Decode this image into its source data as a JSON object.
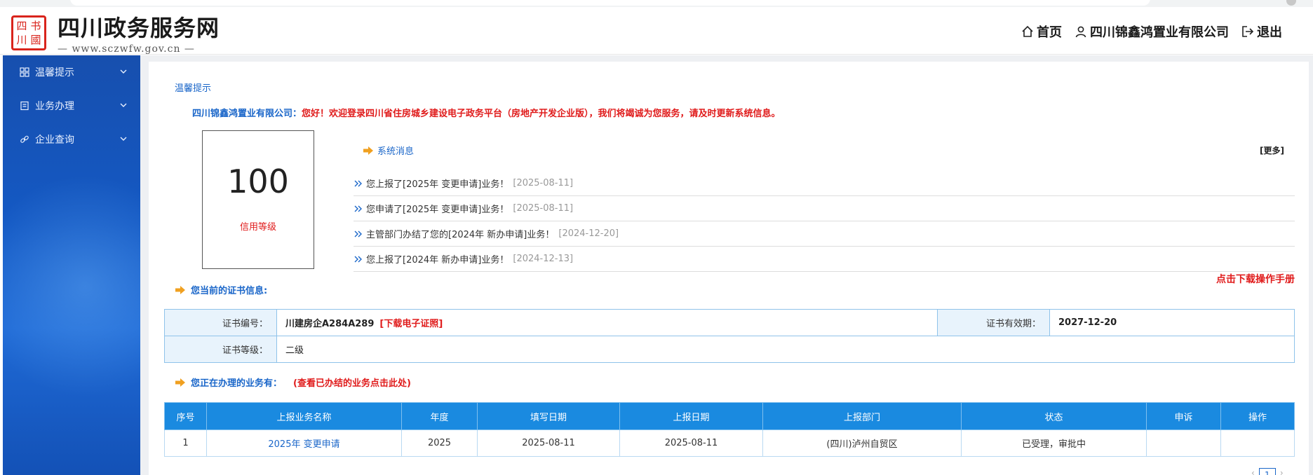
{
  "header": {
    "logo_seal_chars": [
      "四",
      "书",
      "川",
      "國"
    ],
    "site_title": "四川政务服务网",
    "site_url": "www.sczwfw.gov.cn",
    "nav": {
      "home": "首页",
      "company": "四川锦鑫鸿置业有限公司",
      "logout": "退出"
    }
  },
  "sidebar": {
    "items": [
      {
        "label": "温馨提示",
        "icon": "grid-icon"
      },
      {
        "label": "业务办理",
        "icon": "document-icon"
      },
      {
        "label": "企业查询",
        "icon": "link-icon"
      }
    ]
  },
  "main": {
    "tip_title": "温馨提示",
    "welcome_company": "四川锦鑫鸿置业有限公司：",
    "welcome_text": "您好！欢迎登录四川省住房城乡建设电子政务平台（房地产开发企业版），我们将竭诚为您服务，请及时更新系统信息。",
    "credit": {
      "score": "100",
      "label": "信用等级"
    },
    "system_messages": {
      "title": "系统消息",
      "more": "[更多]",
      "items": [
        {
          "text": "您上报了[2025年 变更申请]业务！",
          "date": "[2025-08-11]"
        },
        {
          "text": "您申请了[2025年 变更申请]业务！",
          "date": "[2025-08-11]"
        },
        {
          "text": "主管部门办结了您的[2024年 新办申请]业务！",
          "date": "[2024-12-20]"
        },
        {
          "text": "您上报了[2024年 新办申请]业务！",
          "date": "[2024-12-13]"
        }
      ]
    },
    "manual_link": "点击下载操作手册",
    "certificate": {
      "heading": "您当前的证书信息:",
      "number_label": "证书编号：",
      "number_value": "川建房企A284A289",
      "download_link": "[下载电子证照]",
      "expiry_label": "证书有效期：",
      "expiry_value": "2027-12-20",
      "level_label": "证书等级：",
      "level_value": "二级"
    },
    "business": {
      "heading": "您正在办理的业务有：",
      "view_done_link": "(查看已办结的业务点击此处)",
      "columns": [
        "序号",
        "上报业务名称",
        "年度",
        "填写日期",
        "上报日期",
        "上报部门",
        "状态",
        "申诉",
        "操作"
      ],
      "rows": [
        {
          "no": "1",
          "name": "2025年 变更申请",
          "year": "2025",
          "fill_date": "2025-08-11",
          "report_date": "2025-08-11",
          "dept": "(四川)泸州自贸区",
          "status": "已受理，审批中",
          "appeal": "",
          "action": ""
        }
      ]
    },
    "pager": {
      "current": "1"
    }
  },
  "colors": {
    "brand_blue": "#1a66c9",
    "alert_red": "#e01b1b",
    "table_header": "#1a8ae0",
    "sidebar_bg": "#1459c4",
    "accent_orange": "#f0a020"
  }
}
